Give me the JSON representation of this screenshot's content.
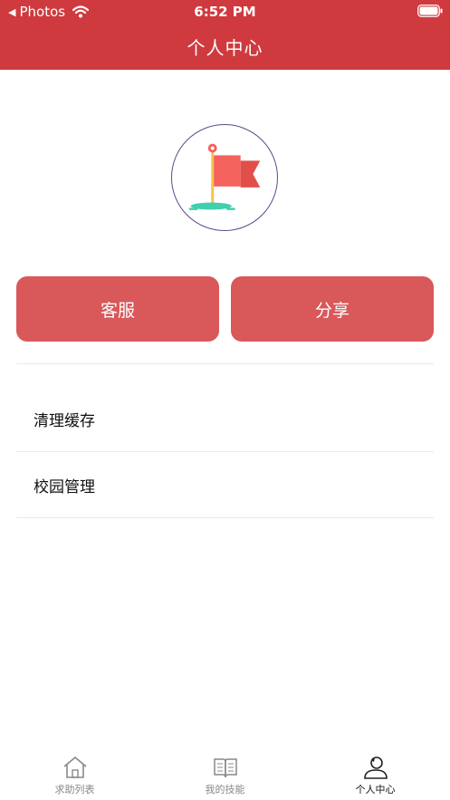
{
  "status_bar": {
    "back_app": "Photos",
    "time": "6:52 PM"
  },
  "header": {
    "title": "个人中心"
  },
  "profile": {
    "avatar_icon": "flag-icon"
  },
  "actions": {
    "service_label": "客服",
    "share_label": "分享"
  },
  "menu": [
    {
      "label": "清理缓存"
    },
    {
      "label": "校园管理"
    }
  ],
  "tabbar": {
    "tabs": [
      {
        "label": "求助列表",
        "icon": "home-icon",
        "active": false
      },
      {
        "label": "我的技能",
        "icon": "book-icon",
        "active": false
      },
      {
        "label": "个人中心",
        "icon": "person-icon",
        "active": true
      }
    ]
  },
  "colors": {
    "header": "#cf3a3e",
    "button": "#d9585a",
    "flag": "#f4625e",
    "avatar_border": "#5b4b8a"
  }
}
